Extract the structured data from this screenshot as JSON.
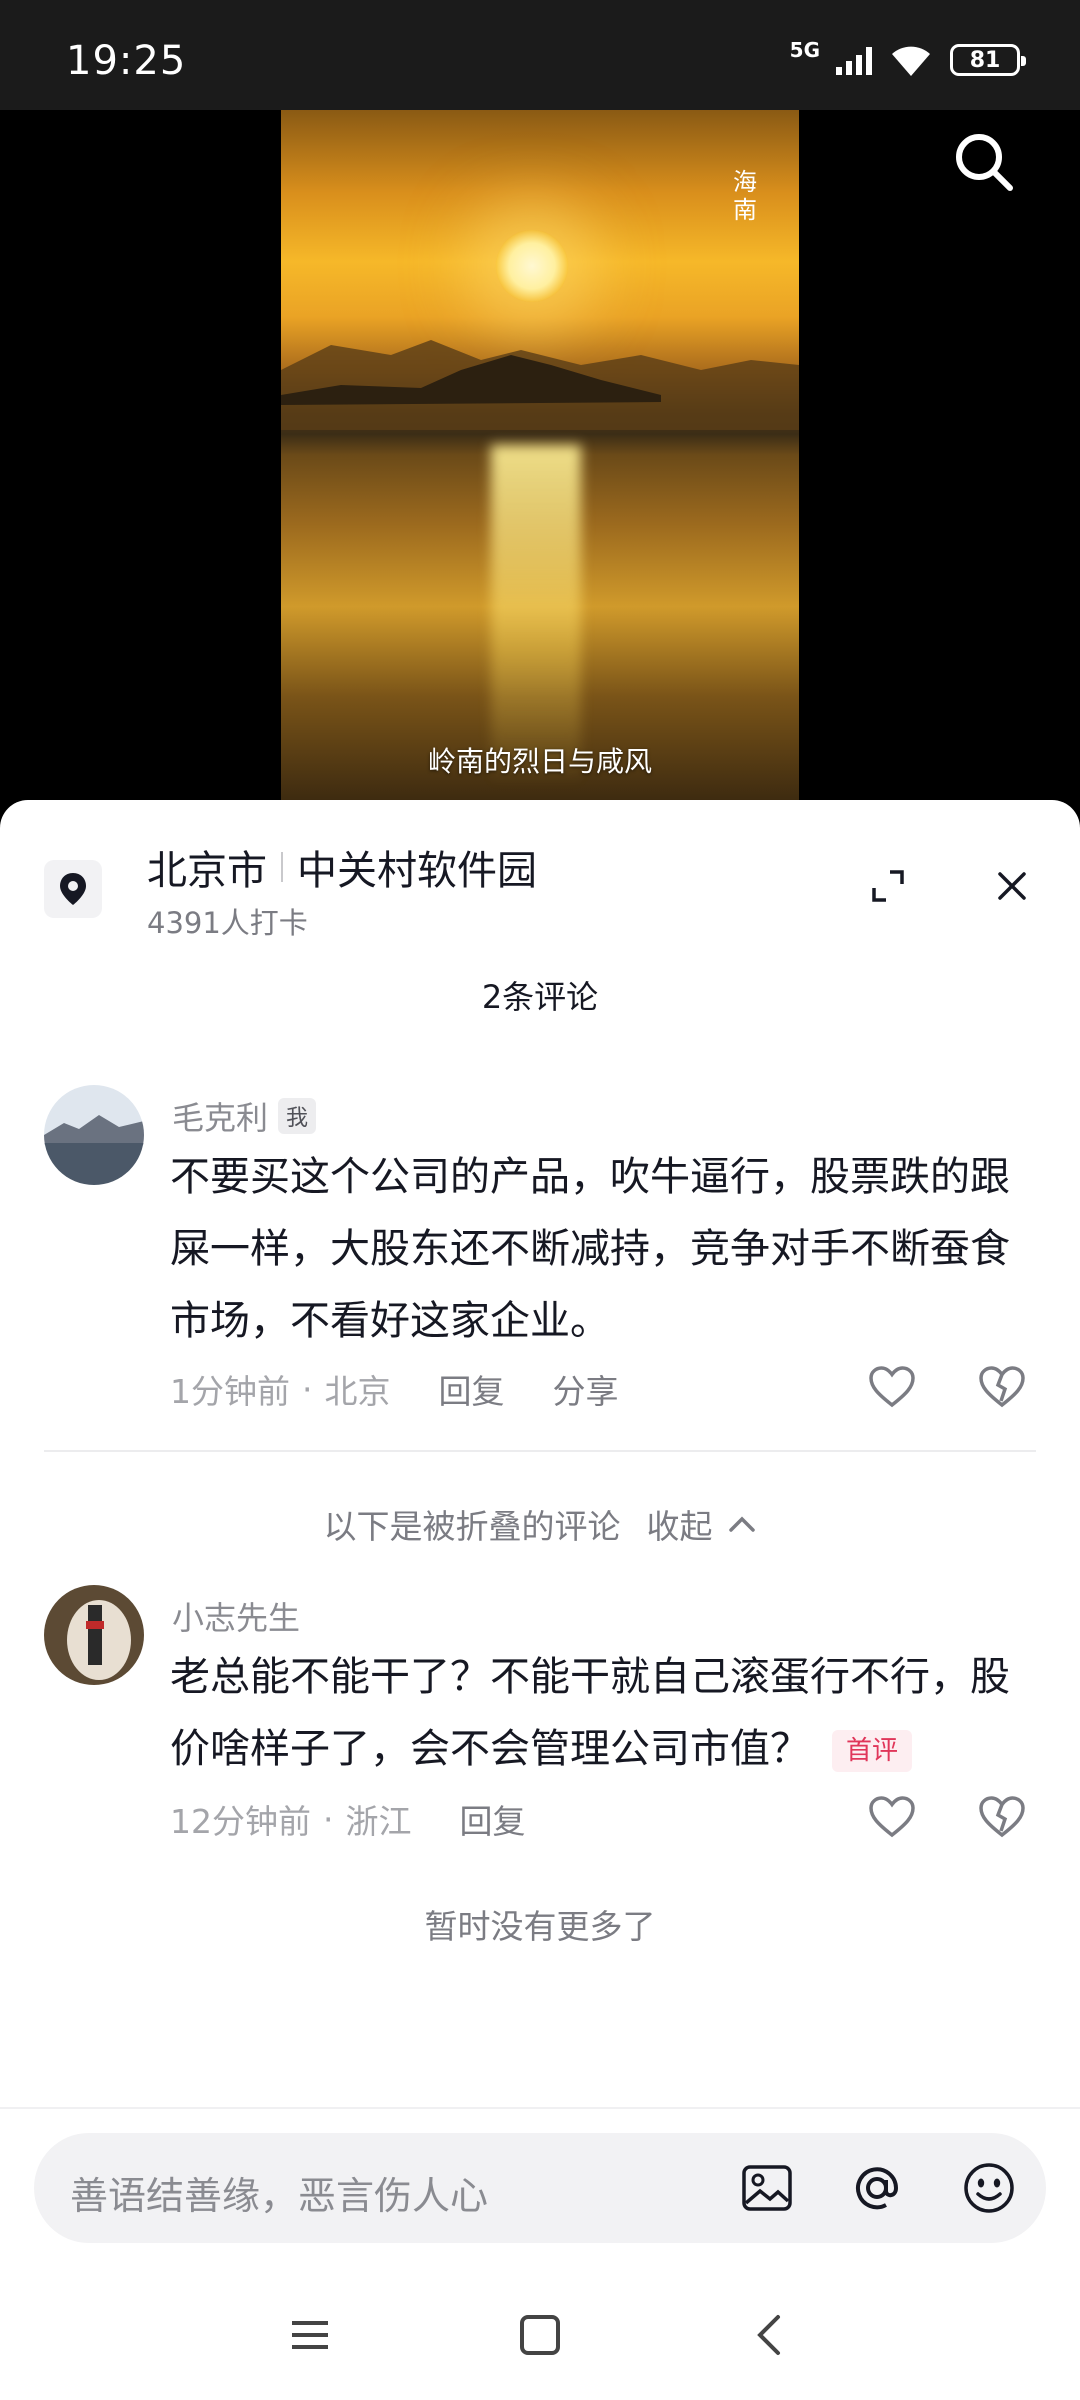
{
  "status_bar": {
    "time": "19:25",
    "network": "5G",
    "battery": "81"
  },
  "video": {
    "vertical_caption": "海南",
    "subtitle": "岭南的烈日与咸风",
    "search_icon": "search-icon"
  },
  "location": {
    "city": "北京市",
    "place": "中关村软件园",
    "checkins": "4391人打卡",
    "pin_icon": "map-pin-icon",
    "expand_icon": "expand-icon",
    "close_icon": "close-icon"
  },
  "comments_header": "2条评论",
  "comments": [
    {
      "name": "毛克利",
      "badge": "我",
      "text": "不要买这个公司的产品，吹牛逼行，股票跌的跟屎一样，大股东还不断减持，竞争对手不断蚕食市场，不看好这家企业。",
      "time": "1分钟前",
      "region": "北京",
      "reply": "回复",
      "share": "分享"
    },
    {
      "name": "小志先生",
      "text": "老总能不能干了？不能干就自己滚蛋行不行，股价啥样子了，会不会管理公司市值？",
      "tag": "首评",
      "time": "12分钟前",
      "region": "浙江",
      "reply": "回复"
    }
  ],
  "folded": {
    "label": "以下是被折叠的评论",
    "collapse": "收起"
  },
  "no_more": "暂时没有更多了",
  "input": {
    "placeholder": "善语结善缘，恶言伤人心"
  },
  "colors": {
    "sheet_bg": "#ffffff",
    "text_primary": "#161823",
    "text_secondary": "#8a8b91",
    "first_tag": "#e0365a"
  }
}
